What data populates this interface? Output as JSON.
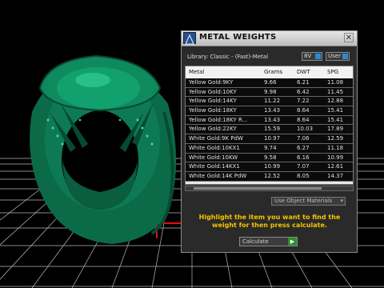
{
  "dialog": {
    "title": "METAL WEIGHTS",
    "close_glyph": "✕",
    "library_label": "Library: Classic - (Fast)-Metal",
    "toggle_8v": "8V",
    "toggle_user": "User",
    "columns": [
      "Metal",
      "Grams",
      "DWT",
      "SPG"
    ],
    "rows": [
      [
        "Yellow Gold:9KY",
        "9.66",
        "6.21",
        "11.08"
      ],
      [
        "Yellow Gold:10KY",
        "9.98",
        "6.42",
        "11.45"
      ],
      [
        "Yellow Gold:14KY",
        "11.22",
        "7.22",
        "12.88"
      ],
      [
        "Yellow Gold:18KY",
        "13.43",
        "8.64",
        "15.41"
      ],
      [
        "Yellow Gold:18KY R...",
        "13.43",
        "8.64",
        "15.41"
      ],
      [
        "Yellow Gold:22KY",
        "15.59",
        "10.03",
        "17.89"
      ],
      [
        "White Gold:9K PdW",
        "10.97",
        "7.06",
        "12.59"
      ],
      [
        "White Gold:10KX1",
        "9.74",
        "6.27",
        "11.18"
      ],
      [
        "White Gold:10KW",
        "9.58",
        "6.16",
        "10.99"
      ],
      [
        "White Gold:14KX1",
        "10.99",
        "7.07",
        "12.61"
      ],
      [
        "White Gold:14K PdW",
        "12.52",
        "8.05",
        "14.37"
      ]
    ],
    "use_materials": "Use Object Materials",
    "instructions": "Highlight the item you want to find the weight for then press calculate.",
    "calculate_label": "Calculate",
    "calculate_glyph": "▶"
  },
  "colors": {
    "ring": "#0e7a55",
    "grid": "#c8c8c8",
    "axis_red": "#e01010",
    "instruction_text": "#f5c400"
  },
  "icons": [
    "app-logo-icon",
    "close-icon",
    "dropdown-arrow-icon",
    "play-icon"
  ]
}
